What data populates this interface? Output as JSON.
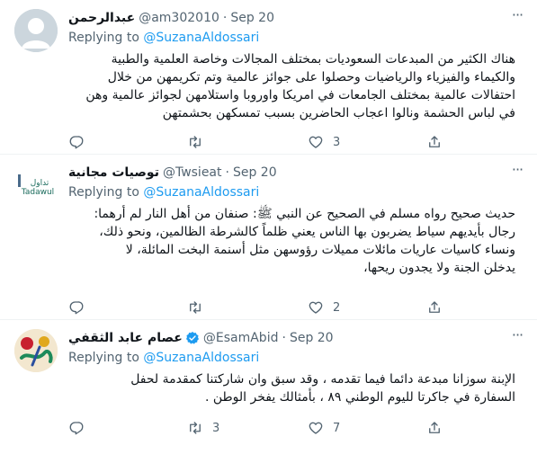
{
  "tweets": [
    {
      "name": "عبدالرحمن",
      "handle": "@am302010",
      "dot": "·",
      "time": "Sep 20",
      "replying_label": "Replying to",
      "replying_to": "@SuzanaAldossari",
      "lines": [
        "هناك الكثير من المبدعات السعوديات بمختلف المجالات وخاصة العلمية والطبية",
        "والكيماء والفيزياء والرياضيات وحصلوا على جوائز عالمية وتم تكريمهن من خلال",
        "احتفالات عالمية بمختلف الجامعات في امريكا واوروبا واستلامهن لجوائز عالمية وهن",
        "في لباس الحشمة ونالوا اعجاب الحاضرين بسبب تمسكهن بحشمتهن"
      ],
      "replies": "",
      "retweets": "",
      "likes": "3",
      "avatar": "default-avatar",
      "more_label": "···"
    },
    {
      "name": "توصيات مجانية",
      "handle": "@Twsieat",
      "dot": "·",
      "time": "Sep 20",
      "replying_label": "Replying to",
      "replying_to": "@SuzanaAldossari",
      "lines": [
        "حديث صحيح رواه مسلم في الصحيح عن النبي ﷺ: صنفان من أهل النار لم أرهما:",
        "رجال بأيديهم سياط يضربون بها الناس يعني ظلماً كالشرطة الظالمين، ونحو ذلك،",
        "ونساء كاسيات عاريات مائلات مميلات رؤوسهن مثل أسنمة البخت المائلة، لا",
        "يدخلن الجنة ولا يجدون ريحها،"
      ],
      "replies": "",
      "retweets": "",
      "likes": "2",
      "avatar": "tadawul-logo",
      "avatar_text": "Tadawul",
      "avatar_text_ar": "تداول",
      "more_label": "···"
    },
    {
      "name": "عصام عابد الثقفي",
      "handle": "@EsamAbid",
      "dot": "·",
      "time": "Sep 20",
      "replying_label": "Replying to",
      "replying_to": "@SuzanaAldossari",
      "lines": [
        "الإبنة سوزانا مبدعة دائما فيما تقدمه ، وقد سبق وان شاركتنا كمقدمة لحفل",
        "السفارة في جاكرتا لليوم الوطني ٨٩ ، بأمثالك يفخر الوطن ."
      ],
      "replies": "",
      "retweets": "3",
      "likes": "7",
      "avatar": "calligraphy-avatar",
      "verified": true,
      "more_label": "···"
    }
  ],
  "colors": {
    "text": "#0f1419",
    "muted": "#536471",
    "link": "#1d9bf0",
    "border": "#eff3f4"
  }
}
